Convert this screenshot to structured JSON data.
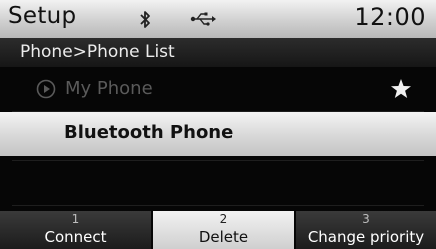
{
  "header": {
    "title": "Setup",
    "time": "12:00",
    "icons": [
      "bluetooth-icon",
      "usb-icon"
    ]
  },
  "breadcrumb": "Phone>Phone List",
  "phone_list": [
    {
      "label": "My Phone",
      "state": "dimmed",
      "icon": "play-icon",
      "badge": "star-icon"
    },
    {
      "label": "Bluetooth Phone",
      "state": "selected"
    }
  ],
  "softkeys": [
    {
      "number": "1",
      "label": "Connect",
      "active": false
    },
    {
      "number": "2",
      "label": "Delete",
      "active": true
    },
    {
      "number": "3",
      "label": "Change priority",
      "active": false
    }
  ],
  "colors": {
    "background": "#060606",
    "highlight": "#dadada",
    "dimmed_text": "#5a5a5a"
  }
}
